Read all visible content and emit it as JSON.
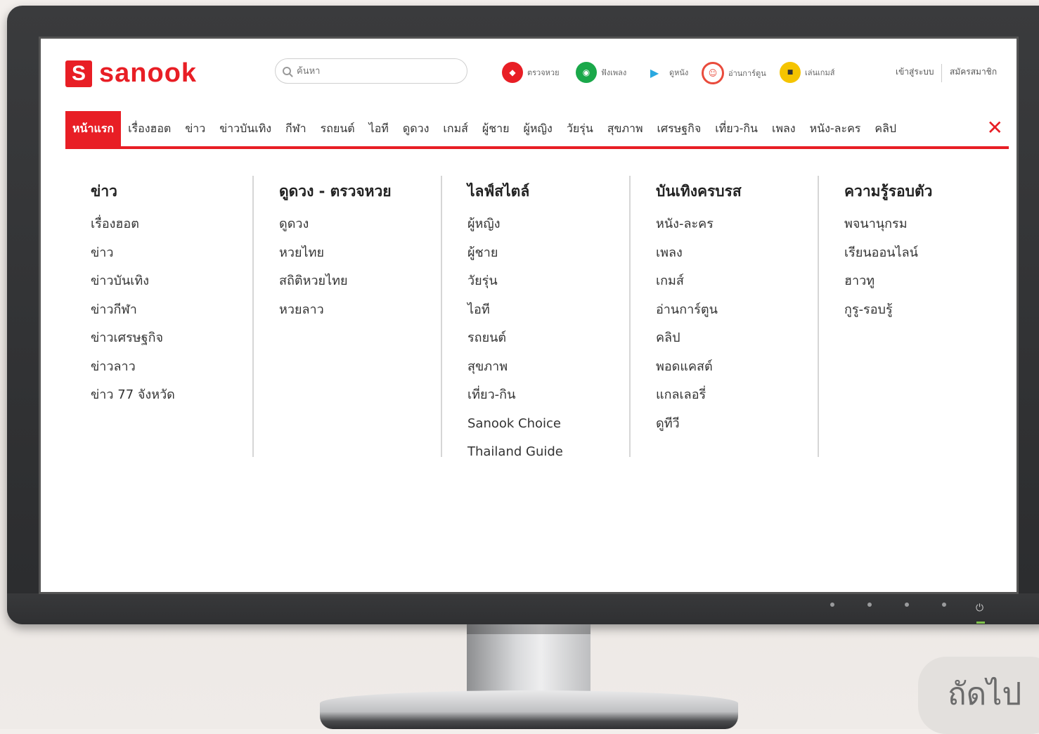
{
  "header": {
    "logo_mark": "S",
    "logo_text": "sanook",
    "search_placeholder": "ค้นหา",
    "quick_links": [
      {
        "label": "ตรวจหวย",
        "icon": "lottery-icon",
        "color": "#e81e25"
      },
      {
        "label": "ฟังเพลง",
        "icon": "music-icon",
        "color": "#1aa84a"
      },
      {
        "label": "ดูหนัง",
        "icon": "play-icon",
        "color": "#2aa8e0"
      },
      {
        "label": "อ่านการ์ตูน",
        "icon": "cartoon-icon",
        "color": "#e94b3c"
      },
      {
        "label": "เล่นเกมส์",
        "icon": "game-icon",
        "color": "#f5c400"
      }
    ],
    "login": "เข้าสู่ระบบ",
    "register": "สมัครสมาชิก"
  },
  "nav": {
    "items": [
      "หน้าแรก",
      "เรื่องฮอต",
      "ข่าว",
      "ข่าวบันเทิง",
      "กีฬา",
      "รถยนต์",
      "ไอที",
      "ดูดวง",
      "เกมส์",
      "ผู้ชาย",
      "ผู้หญิง",
      "วัยรุ่น",
      "สุขภาพ",
      "เศรษฐกิจ",
      "เที่ยว-กิน",
      "เพลง",
      "หนัง-ละคร",
      "คลิป"
    ],
    "active_index": 0,
    "close": "✕"
  },
  "menu": {
    "columns": [
      {
        "title": "ข่าว",
        "links": [
          "เรื่องฮอต",
          "ข่าว",
          "ข่าวบันเทิง",
          "ข่าวกีฬา",
          "ข่าวเศรษฐกิจ",
          "ข่าวลาว",
          "ข่าว 77 จังหวัด"
        ]
      },
      {
        "title": "ดูดวง - ตรวจหวย",
        "links": [
          "ดูดวง",
          "หวยไทย",
          "สถิติหวยไทย",
          "หวยลาว"
        ]
      },
      {
        "title": "ไลฟ์สไตล์",
        "links": [
          "ผู้หญิง",
          "ผู้ชาย",
          "วัยรุ่น",
          "ไอที",
          "รถยนต์",
          "สุขภาพ",
          "เที่ยว-กิน",
          "Sanook Choice",
          "Thailand Guide"
        ]
      },
      {
        "title": "บันเทิงครบรส",
        "links": [
          "หนัง-ละคร",
          "เพลง",
          "เกมส์",
          "อ่านการ์ตูน",
          "คลิป",
          "พอดแคสต์",
          "แกลเลอรี่",
          "ดูทีวี"
        ]
      },
      {
        "title": "ความรู้รอบตัว",
        "links": [
          "พจนานุกรม",
          "เรียนออนไลน์",
          "ฮาวทู",
          "กูรู-รอบรู้"
        ]
      }
    ]
  },
  "next_button": "ถัดไป",
  "colors": {
    "brand": "#e81e25"
  }
}
